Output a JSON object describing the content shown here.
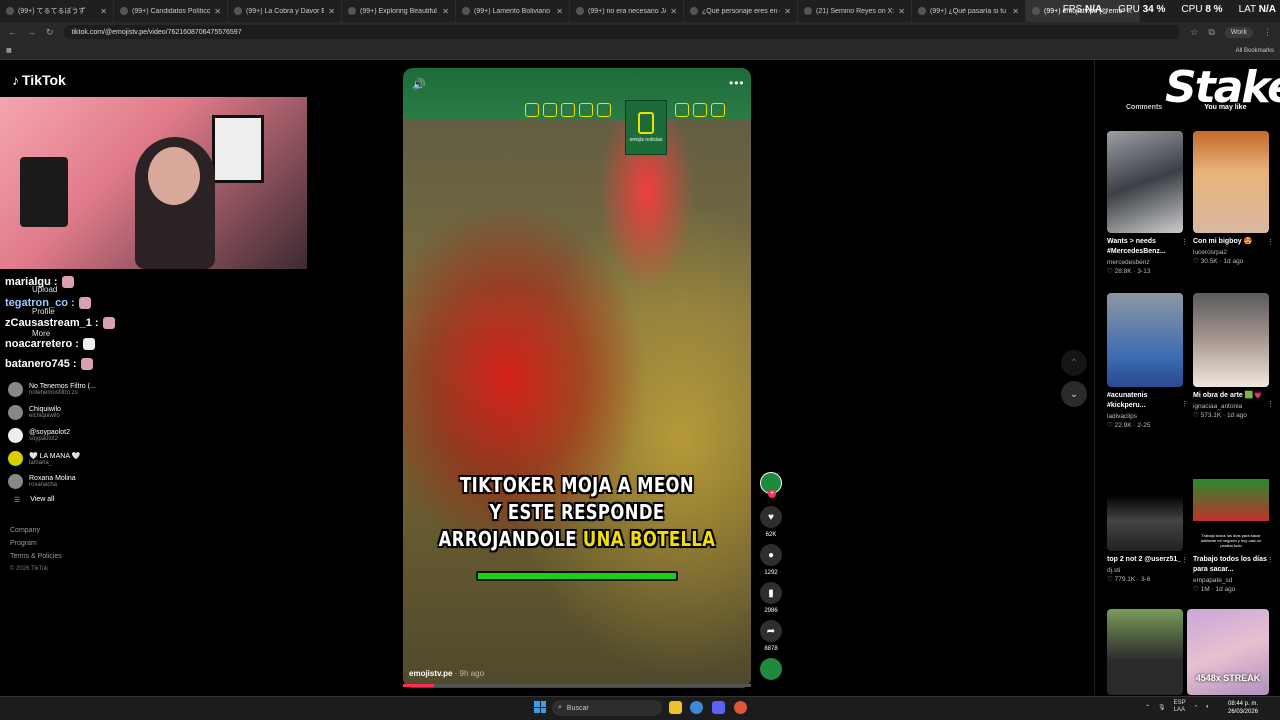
{
  "browser": {
    "tabs": [
      "(99+) てるてるぼうず",
      "(99+) Candidatos Políticos en",
      "(99+) La Cobra y Davor El Du",
      "(99+) Exploring Beautiful Plac",
      "(99+) Lamento Boliviano Pow",
      "(99+) no era necesario JAJA",
      "¿Qué personaje eres en esta",
      "(21) Semino Reyes on X: \"Sylv",
      "(99+) ¿Qué pasaría si tu viejo",
      "(99+) emojistv.pe (@emo"
    ],
    "url": "tiktok.com/@emojistv.pe/video/7621608706475576597",
    "profile_label": "Work",
    "bookmarks_label": "All Bookmarks"
  },
  "overlay": {
    "fps_label": "FPS",
    "fps_value": "N/A",
    "gpu_label": "GPU",
    "gpu_value": "34 %",
    "cpu_label": "CPU",
    "cpu_value": "8 %",
    "lat_label": "LAT",
    "lat_value": "N/A"
  },
  "tiktok": {
    "logo": "TikTok",
    "chat": [
      {
        "user": "marialgu :"
      },
      {
        "user": "tegatron_co :"
      },
      {
        "user": "zCausastream_1 :"
      },
      {
        "user": "noacarretero :"
      },
      {
        "user": "batanero745 :"
      }
    ],
    "ghost_nav": {
      "upload": "Upload",
      "profile": "Profile",
      "more": "More"
    },
    "following": [
      {
        "name": "No Tenemos Filtro (...",
        "handle": "notenemosfiltro.zs"
      },
      {
        "name": "Chiquiwilo",
        "handle": "elchiquiwilo"
      },
      {
        "name": "@soypaolot2",
        "handle": "soypaolot2"
      },
      {
        "name": "🤍 LA MANA 🤍",
        "handle": "lamana_"
      },
      {
        "name": "Roxana Molina",
        "handle": "roxanacha"
      }
    ],
    "view_all": "View all",
    "footer": [
      "Company",
      "Program",
      "Terms & Policies"
    ],
    "copyright": "© 2026 TikTok"
  },
  "video": {
    "caption_line1": "TIKTOKER MOJA A MEON",
    "caption_line2": "Y ESTE RESPONDE",
    "caption_line3_white": "ARROJANDOLE ",
    "caption_line3_yellow": "UNA BOTELLA",
    "brand_label": "emojis noticias",
    "author": "emojistv.pe",
    "posted": "· 9h ago",
    "progress": 0.09
  },
  "actions": {
    "likes": "62K",
    "comments": "1292",
    "saves": "2986",
    "shares": "8878"
  },
  "right_panel": {
    "brand": "Stake",
    "tab_comments": "Comments",
    "tab_you_may_like": "You may like",
    "cards": [
      {
        "title": "Wants > needs #MercedesBenz...",
        "author": "mercedesbenz",
        "likes": "28.8K",
        "date": "3-13"
      },
      {
        "title": "Con mi bigboy 😍",
        "author": "lucerosrpa2",
        "likes": "30.5K",
        "date": "1d ago"
      },
      {
        "title": "#acunatenis #kickperu...",
        "author": "ladivaclips",
        "likes": "22.9K",
        "date": "2-25"
      },
      {
        "title": "Mi obra de arte 🟩💗",
        "author": "ignaciaa_antonia",
        "likes": "573.1K",
        "date": "1d ago"
      },
      {
        "title": "top 2 not 2 @userz51_",
        "author": "dj.sti",
        "likes": "779.1K",
        "date": "3-6"
      },
      {
        "title": "Trabajo todos los días para sacar...",
        "author": "empapate_sd",
        "likes": "1M",
        "date": "1d ago"
      },
      {
        "title": "",
        "author": "",
        "likes": "",
        "date": ""
      },
      {
        "title": "",
        "author": "",
        "likes": "",
        "date": ""
      }
    ],
    "streak_label": "4548x STREAK",
    "thumb_caption": "Trabajo todos los días para sacar adelante mi negocio y hoy casi no paraba todo"
  },
  "taskbar": {
    "search_placeholder": "Buscar",
    "lang_line1": "ESP",
    "lang_line2": "LAA",
    "time": "08:44 p. m.",
    "date": "26/03/2026"
  },
  "colors": {
    "accent": "#fe2c55",
    "caption_yellow": "#f4e000",
    "green_bar": "#18d018"
  }
}
